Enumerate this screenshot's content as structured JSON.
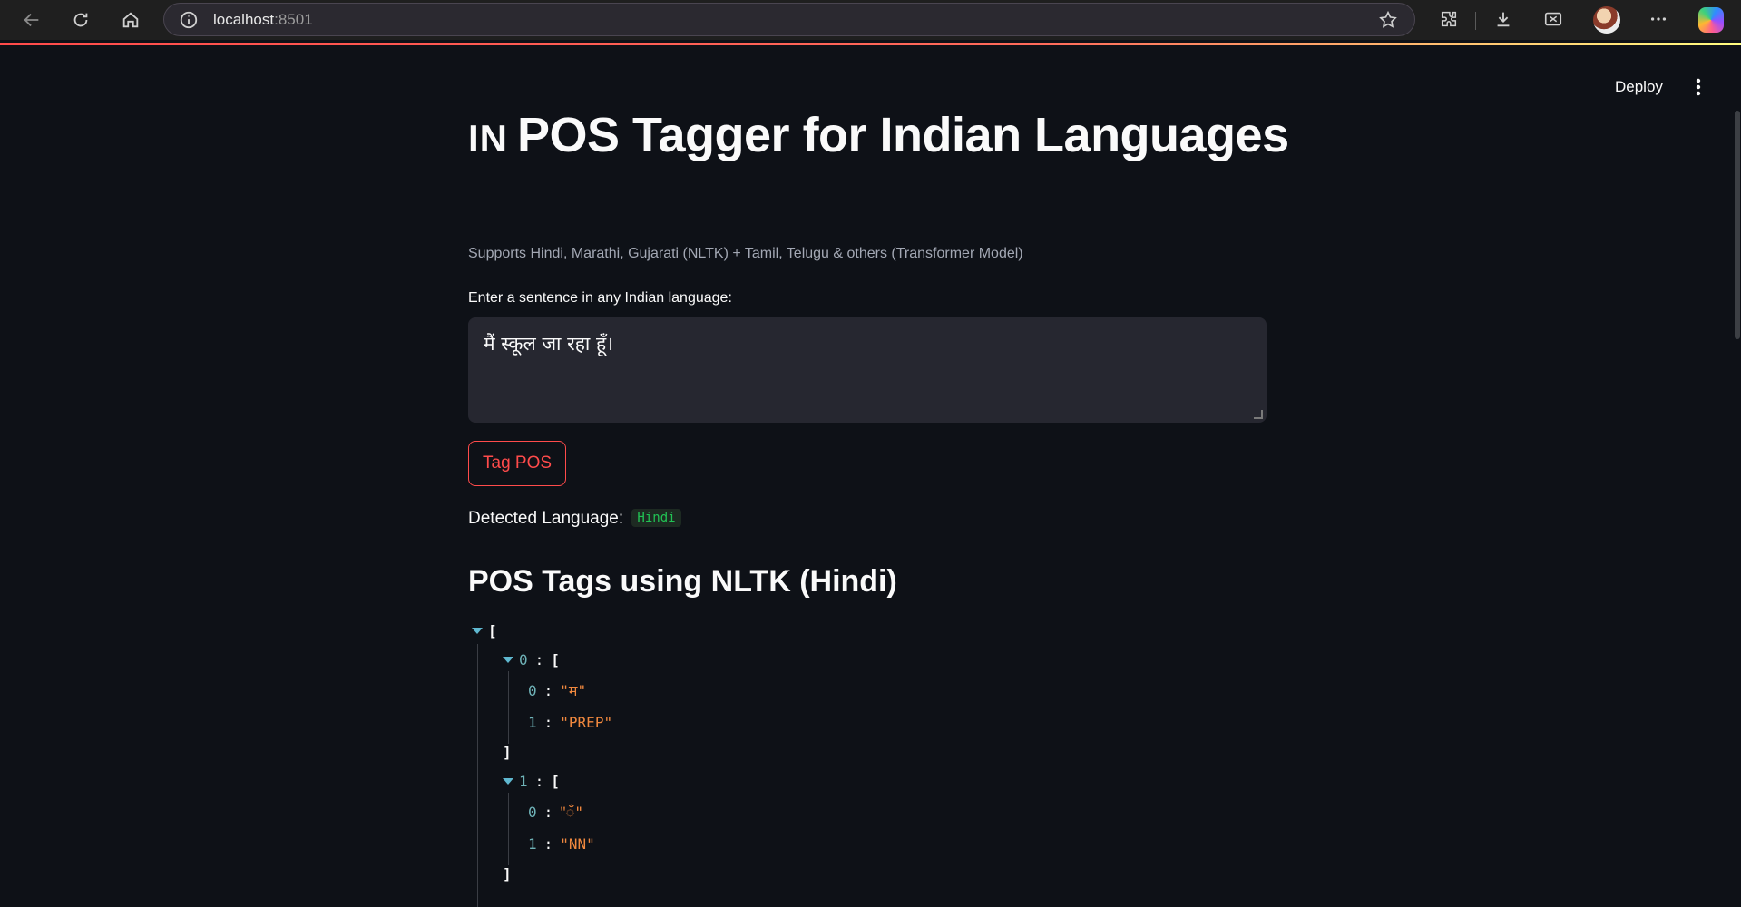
{
  "browser": {
    "url_host": "localhost",
    "url_port": ":8501"
  },
  "app": {
    "deploy_label": "Deploy",
    "title_flag": "IN",
    "title": "POS Tagger for Indian Languages",
    "caption": "Supports Hindi, Marathi, Gujarati (NLTK) + Tamil, Telugu & others (Transformer Model)",
    "input_label": "Enter a sentence in any Indian language:",
    "input_value": "मैं स्कूल जा रहा हूँ।",
    "tag_button": "Tag POS",
    "detected_label": "Detected Language:",
    "detected_value": "Hindi",
    "section_title": "POS Tags using NLTK (Hindi)"
  },
  "json_tree": {
    "open": "[",
    "close": "]",
    "items": [
      {
        "index": "0",
        "word": "\"म\"",
        "tag": "\"PREP\""
      },
      {
        "index": "1",
        "word": "\"ँ\"",
        "tag": "\"NN\""
      }
    ]
  },
  "colors": {
    "background": "#0e1117",
    "accent": "#ff4b4b",
    "code_green": "#21c354",
    "json_string": "#f0883e",
    "json_key": "#6fb3b8"
  }
}
